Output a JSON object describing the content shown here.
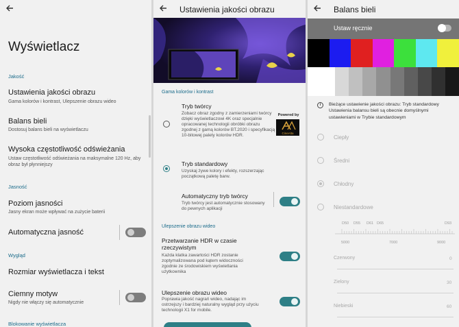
{
  "panel1": {
    "title": "Wyświetlacz",
    "sections": {
      "quality": "Jakość",
      "brightness": "Jasność",
      "look": "Wygląd",
      "lock": "Blokowanie wyświetlacza"
    },
    "items": {
      "picture_quality": {
        "title": "Ustawienia jakości obrazu",
        "sub": "Gama kolorów i kontrast, Ulepszenie obrazu wideo"
      },
      "white_balance": {
        "title": "Balans bieli",
        "sub": "Dostosuj balans bieli na wyświetlaczu"
      },
      "refresh": {
        "title": "Wysoka częstotliwość odświeżania",
        "sub": "Ustaw częstotliwość odświeżania na maksymalne 120 Hz, aby obraz był płynniejszy"
      },
      "brightness_level": {
        "title": "Poziom jasności",
        "sub": "Jasny ekran może wpływać na zużycie baterii"
      },
      "auto_brightness": {
        "title": "Automatyczna jasność",
        "enabled": false
      },
      "font_size": {
        "title": "Rozmiar wyświetlacza i tekst"
      },
      "dark_theme": {
        "title": "Ciemny motyw",
        "sub": "Nigdy nie włączy się automatycznie",
        "enabled": false
      }
    }
  },
  "panel2": {
    "title": "Ustawienia jakości obrazu",
    "section_gamut": "Gama kolorów i kontrast",
    "creator": {
      "title": "Tryb twórcy",
      "desc": "Zobacz obraz zgodny z zamierzeniami twórcy dzięki wyświetlaczowi 4K oraz specjalnie opracowanej technologii obróbki obrazu zgodnej z gamą kolorów BT.2020 i specyfikacją 10-bitowej palety kolorów HDR.",
      "selected": false
    },
    "powered_by": "Powered by",
    "cinealta": "CineAlta",
    "standard": {
      "title": "Tryb standardowy",
      "desc": "Uzyskaj żywe kolory i efekty, rozszerzając początkową paletę barw.",
      "selected": true
    },
    "auto_creator": {
      "title": "Automatyczny tryb twórcy",
      "desc": "Tryb twórcy jest automatycznie stosowany do pewnych aplikacji",
      "enabled": true
    },
    "section_video": "Ulepszenie obrazu wideo",
    "hdr": {
      "title": "Przetwarzanie HDR w czasie rzeczywistym",
      "desc": "Każda klatka zawartości HDR zostanie zoptymalizowana pod kątem widoczności zgodnie ze środowiskiem wyświetlania użytkownika",
      "enabled": true
    },
    "video_enh": {
      "title": "Ulepszenie obrazu wideo",
      "desc": "Poprawia jakość nagrań wideo, nadając im ostrzejszy i bardziej naturalny wygląd przy użyciu technologii X1 for mobile.",
      "enabled": true
    }
  },
  "panel3": {
    "title": "Balans bieli",
    "manual_label": "Ustaw ręcznie",
    "manual_enabled": false,
    "color_bars": [
      "#000000",
      "#1c1cf0",
      "#e02020",
      "#e020e0",
      "#3ce03c",
      "#5ee8f0",
      "#f0f03c"
    ],
    "gray_bars": [
      "#ffffff",
      "#ffffff",
      "#d8d8d8",
      "#c0c0c0",
      "#a8a8a8",
      "#909090",
      "#787878",
      "#606060",
      "#484848",
      "#303030",
      "#181818"
    ],
    "info": "Bieżące ustawienie jakości obrazu: Tryb standardowy\nUstawienia balansu bieli są obecnie domyślnymi ustawieniami w Trybie standardowym",
    "options": [
      "Ciepły",
      "Średni",
      "Chłodny",
      "Niestandardowe"
    ],
    "selected_option": "Chłodny",
    "ticks_top": [
      "D50",
      "D55",
      "D61",
      "D65",
      "D93"
    ],
    "ticks_bottom": [
      "5000",
      "7000",
      "9000"
    ],
    "channels": [
      {
        "label": "Czerwony",
        "value": "0"
      },
      {
        "label": "Zielony",
        "value": "30"
      },
      {
        "label": "Niebieski",
        "value": "60"
      }
    ]
  }
}
